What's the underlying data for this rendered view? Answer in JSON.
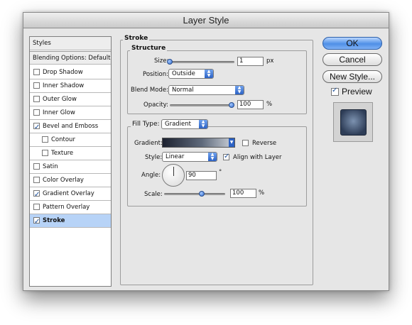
{
  "window": {
    "title": "Layer Style"
  },
  "sidebar": {
    "header": "Styles",
    "blending": "Blending Options: Default",
    "items": [
      {
        "label": "Drop Shadow",
        "checked": false
      },
      {
        "label": "Inner Shadow",
        "checked": false
      },
      {
        "label": "Outer Glow",
        "checked": false
      },
      {
        "label": "Inner Glow",
        "checked": false
      },
      {
        "label": "Bevel and Emboss",
        "checked": true
      },
      {
        "label": "Contour",
        "checked": false
      },
      {
        "label": "Texture",
        "checked": false
      },
      {
        "label": "Satin",
        "checked": false
      },
      {
        "label": "Color Overlay",
        "checked": false
      },
      {
        "label": "Gradient Overlay",
        "checked": true
      },
      {
        "label": "Pattern Overlay",
        "checked": false
      },
      {
        "label": "Stroke",
        "checked": true
      }
    ]
  },
  "stroke": {
    "title": "Stroke",
    "structure": {
      "title": "Structure",
      "size_label": "Size:",
      "size_value": "1",
      "size_unit": "px",
      "position_label": "Position:",
      "position_value": "Outside",
      "blend_label": "Blend Mode:",
      "blend_value": "Normal",
      "opacity_label": "Opacity:",
      "opacity_value": "100",
      "opacity_unit": "%"
    },
    "fill": {
      "type_label": "Fill Type:",
      "type_value": "Gradient",
      "gradient_label": "Gradient:",
      "reverse_label": "Reverse",
      "style_label": "Style:",
      "style_value": "Linear",
      "align_label": "Align with Layer",
      "angle_label": "Angle:",
      "angle_value": "90",
      "angle_unit": "°",
      "scale_label": "Scale:",
      "scale_value": "100",
      "scale_unit": "%"
    }
  },
  "buttons": {
    "ok": "OK",
    "cancel": "Cancel",
    "new_style": "New Style...",
    "preview": "Preview"
  }
}
